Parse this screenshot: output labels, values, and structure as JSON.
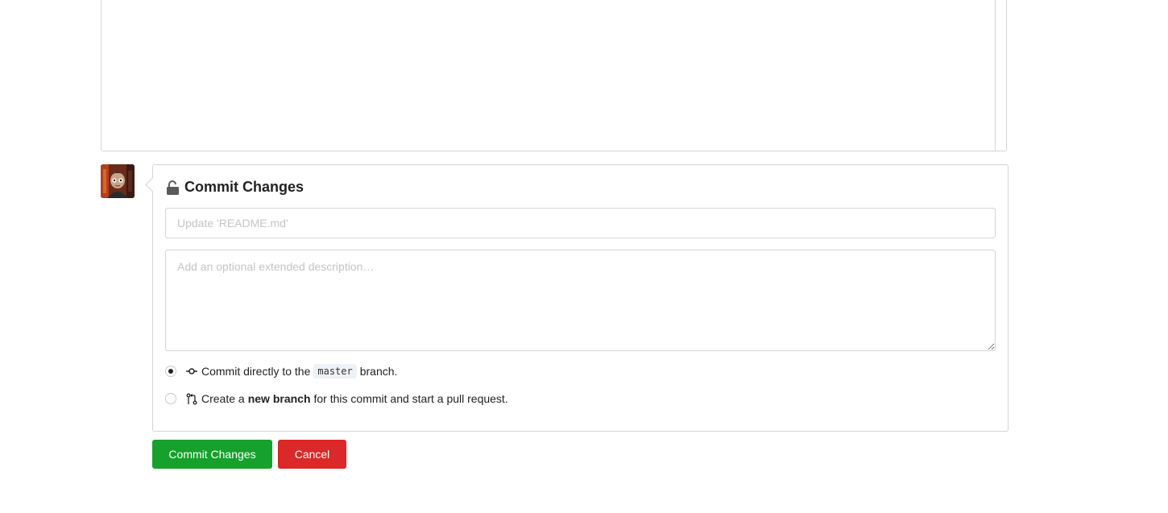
{
  "commit": {
    "title": "Commit Changes",
    "summary_placeholder": "Update 'README.md'",
    "description_placeholder": "Add an optional extended description…",
    "options": [
      {
        "selected": true,
        "icon": "git-commit-icon",
        "prefix": "Commit directly to the",
        "branch": "master",
        "suffix": "branch."
      },
      {
        "selected": false,
        "icon": "git-pull-request-icon",
        "prefix": "Create a",
        "bold": "new branch",
        "suffix": "for this commit and start a pull request."
      }
    ]
  },
  "buttons": {
    "commit_label": "Commit Changes",
    "cancel_label": "Cancel"
  },
  "colors": {
    "commit_button": "#16a02c",
    "cancel_button": "#db2828"
  }
}
